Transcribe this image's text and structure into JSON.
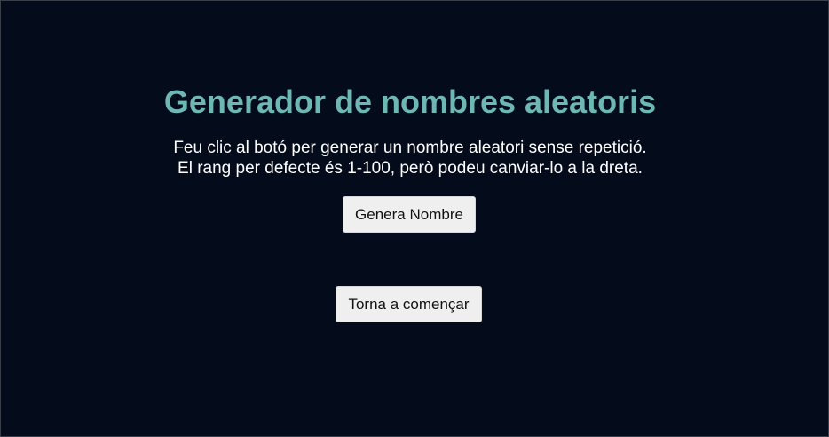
{
  "main": {
    "title": "Generador de nombres aleatoris",
    "description_line1": "Feu clic al botó per generar un nombre aleatori sense repetició.",
    "description_line2": "El rang per defecte és 1-100, però podeu canviar-lo a la dreta.",
    "generate_button_label": "Genera Nombre",
    "restart_button_label": "Torna a començar"
  },
  "colors": {
    "background": "#040b1b",
    "title": "#6db8b5",
    "text": "#ffffff",
    "button_bg": "#efefef"
  }
}
